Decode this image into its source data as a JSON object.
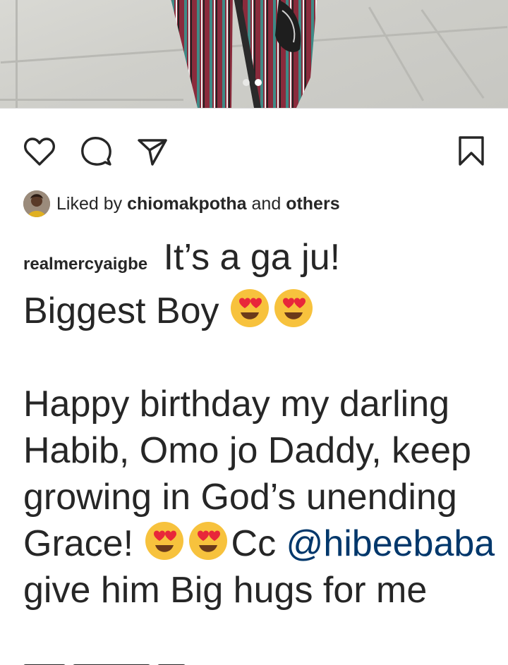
{
  "post": {
    "media": {
      "description_icon": "photo",
      "carousel": {
        "count": 2,
        "active": 2
      }
    },
    "actions": {
      "like_icon": "heart-icon",
      "comment_icon": "comment-icon",
      "share_icon": "send-icon",
      "save_icon": "bookmark-icon"
    },
    "likes": {
      "prefix": "Liked by",
      "user": "chiomakpotha",
      "conjunction": "and",
      "others": "others"
    },
    "caption": {
      "username": "realmercyaigbe",
      "line1": "It’s a ga ju!",
      "line2": "Biggest Boy",
      "body_a": "Happy birthday my darling Habib, Omo jo Daddy, keep growing in God’s unending Grace!",
      "body_b": "Cc",
      "mention": "@hibeebaba",
      "body_c": "give him Big hugs for me"
    }
  },
  "colors": {
    "text": "#262626",
    "mention": "#00376b",
    "background": "#ffffff"
  }
}
